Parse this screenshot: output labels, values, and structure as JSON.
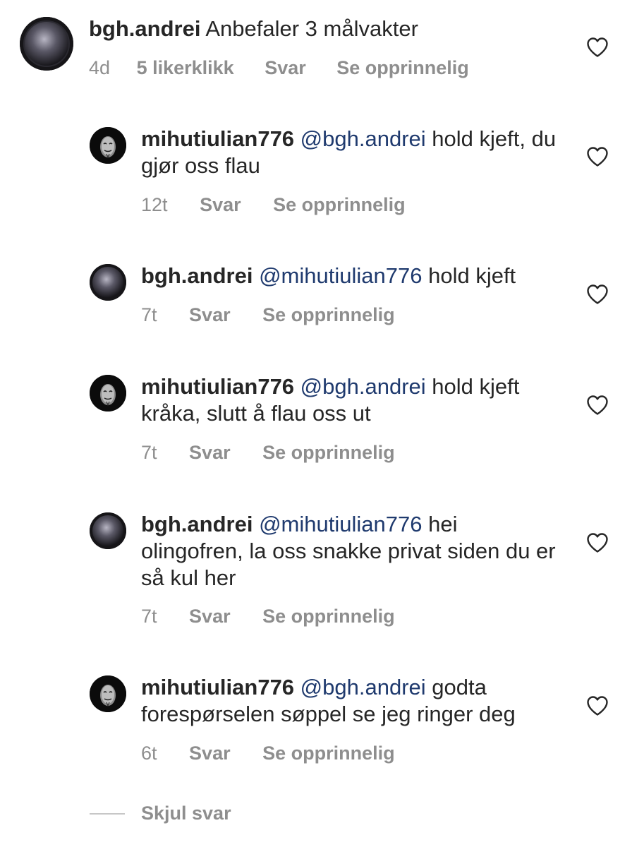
{
  "comments": [
    {
      "username": "bgh.andrei",
      "mention": "",
      "text": "Anbefaler 3 målvakter",
      "time": "4d",
      "likes": "5 likerklikk",
      "reply": "Svar",
      "original": "Se opprinnelig",
      "avatar": "dark-orb-avatar"
    },
    {
      "username": "mihutiulian776",
      "mention": "@bgh.andrei",
      "text": "hold kjeft, du gjør oss flau",
      "time": "12t",
      "reply": "Svar",
      "original": "Se opprinnelig",
      "avatar": "mask-avatar"
    },
    {
      "username": "bgh.andrei",
      "mention": "@mihutiulian776",
      "text": "hold kjeft",
      "time": "7t",
      "reply": "Svar",
      "original": "Se opprinnelig",
      "avatar": "dark-orb-avatar"
    },
    {
      "username": "mihutiulian776",
      "mention": "@bgh.andrei",
      "text": "hold kjeft kråka, slutt å flau oss ut",
      "time": "7t",
      "reply": "Svar",
      "original": "Se opprinnelig",
      "avatar": "mask-avatar"
    },
    {
      "username": "bgh.andrei",
      "mention": "@mihutiulian776",
      "text": "hei olingofren, la oss snakke privat siden du er så kul her",
      "time": "7t",
      "reply": "Svar",
      "original": "Se opprinnelig",
      "avatar": "dark-orb-avatar"
    },
    {
      "username": "mihutiulian776",
      "mention": "@bgh.andrei",
      "text": "godta forespørselen søppel se jeg ringer deg",
      "time": "6t",
      "reply": "Svar",
      "original": "Se opprinnelig",
      "avatar": "mask-avatar"
    }
  ],
  "hide_replies": "Skjul svar",
  "icons": {
    "like": "heart-outline-icon"
  },
  "colors": {
    "text": "#262626",
    "meta": "#8e8e8e",
    "mention": "#1f3a6e",
    "divider": "#c7c7c7"
  }
}
